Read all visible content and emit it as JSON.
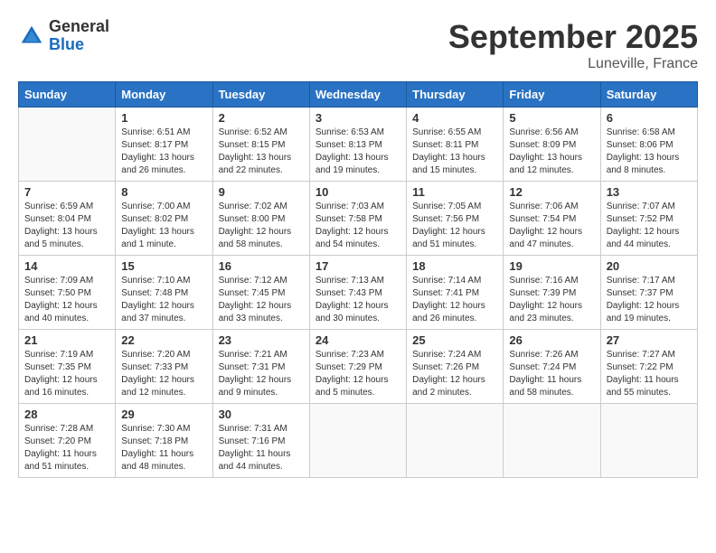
{
  "header": {
    "logo_general": "General",
    "logo_blue": "Blue",
    "title": "September 2025",
    "location": "Luneville, France"
  },
  "days_of_week": [
    "Sunday",
    "Monday",
    "Tuesday",
    "Wednesday",
    "Thursday",
    "Friday",
    "Saturday"
  ],
  "weeks": [
    [
      {
        "day": "",
        "info": ""
      },
      {
        "day": "1",
        "info": "Sunrise: 6:51 AM\nSunset: 8:17 PM\nDaylight: 13 hours\nand 26 minutes."
      },
      {
        "day": "2",
        "info": "Sunrise: 6:52 AM\nSunset: 8:15 PM\nDaylight: 13 hours\nand 22 minutes."
      },
      {
        "day": "3",
        "info": "Sunrise: 6:53 AM\nSunset: 8:13 PM\nDaylight: 13 hours\nand 19 minutes."
      },
      {
        "day": "4",
        "info": "Sunrise: 6:55 AM\nSunset: 8:11 PM\nDaylight: 13 hours\nand 15 minutes."
      },
      {
        "day": "5",
        "info": "Sunrise: 6:56 AM\nSunset: 8:09 PM\nDaylight: 13 hours\nand 12 minutes."
      },
      {
        "day": "6",
        "info": "Sunrise: 6:58 AM\nSunset: 8:06 PM\nDaylight: 13 hours\nand 8 minutes."
      }
    ],
    [
      {
        "day": "7",
        "info": "Sunrise: 6:59 AM\nSunset: 8:04 PM\nDaylight: 13 hours\nand 5 minutes."
      },
      {
        "day": "8",
        "info": "Sunrise: 7:00 AM\nSunset: 8:02 PM\nDaylight: 13 hours\nand 1 minute."
      },
      {
        "day": "9",
        "info": "Sunrise: 7:02 AM\nSunset: 8:00 PM\nDaylight: 12 hours\nand 58 minutes."
      },
      {
        "day": "10",
        "info": "Sunrise: 7:03 AM\nSunset: 7:58 PM\nDaylight: 12 hours\nand 54 minutes."
      },
      {
        "day": "11",
        "info": "Sunrise: 7:05 AM\nSunset: 7:56 PM\nDaylight: 12 hours\nand 51 minutes."
      },
      {
        "day": "12",
        "info": "Sunrise: 7:06 AM\nSunset: 7:54 PM\nDaylight: 12 hours\nand 47 minutes."
      },
      {
        "day": "13",
        "info": "Sunrise: 7:07 AM\nSunset: 7:52 PM\nDaylight: 12 hours\nand 44 minutes."
      }
    ],
    [
      {
        "day": "14",
        "info": "Sunrise: 7:09 AM\nSunset: 7:50 PM\nDaylight: 12 hours\nand 40 minutes."
      },
      {
        "day": "15",
        "info": "Sunrise: 7:10 AM\nSunset: 7:48 PM\nDaylight: 12 hours\nand 37 minutes."
      },
      {
        "day": "16",
        "info": "Sunrise: 7:12 AM\nSunset: 7:45 PM\nDaylight: 12 hours\nand 33 minutes."
      },
      {
        "day": "17",
        "info": "Sunrise: 7:13 AM\nSunset: 7:43 PM\nDaylight: 12 hours\nand 30 minutes."
      },
      {
        "day": "18",
        "info": "Sunrise: 7:14 AM\nSunset: 7:41 PM\nDaylight: 12 hours\nand 26 minutes."
      },
      {
        "day": "19",
        "info": "Sunrise: 7:16 AM\nSunset: 7:39 PM\nDaylight: 12 hours\nand 23 minutes."
      },
      {
        "day": "20",
        "info": "Sunrise: 7:17 AM\nSunset: 7:37 PM\nDaylight: 12 hours\nand 19 minutes."
      }
    ],
    [
      {
        "day": "21",
        "info": "Sunrise: 7:19 AM\nSunset: 7:35 PM\nDaylight: 12 hours\nand 16 minutes."
      },
      {
        "day": "22",
        "info": "Sunrise: 7:20 AM\nSunset: 7:33 PM\nDaylight: 12 hours\nand 12 minutes."
      },
      {
        "day": "23",
        "info": "Sunrise: 7:21 AM\nSunset: 7:31 PM\nDaylight: 12 hours\nand 9 minutes."
      },
      {
        "day": "24",
        "info": "Sunrise: 7:23 AM\nSunset: 7:29 PM\nDaylight: 12 hours\nand 5 minutes."
      },
      {
        "day": "25",
        "info": "Sunrise: 7:24 AM\nSunset: 7:26 PM\nDaylight: 12 hours\nand 2 minutes."
      },
      {
        "day": "26",
        "info": "Sunrise: 7:26 AM\nSunset: 7:24 PM\nDaylight: 11 hours\nand 58 minutes."
      },
      {
        "day": "27",
        "info": "Sunrise: 7:27 AM\nSunset: 7:22 PM\nDaylight: 11 hours\nand 55 minutes."
      }
    ],
    [
      {
        "day": "28",
        "info": "Sunrise: 7:28 AM\nSunset: 7:20 PM\nDaylight: 11 hours\nand 51 minutes."
      },
      {
        "day": "29",
        "info": "Sunrise: 7:30 AM\nSunset: 7:18 PM\nDaylight: 11 hours\nand 48 minutes."
      },
      {
        "day": "30",
        "info": "Sunrise: 7:31 AM\nSunset: 7:16 PM\nDaylight: 11 hours\nand 44 minutes."
      },
      {
        "day": "",
        "info": ""
      },
      {
        "day": "",
        "info": ""
      },
      {
        "day": "",
        "info": ""
      },
      {
        "day": "",
        "info": ""
      }
    ]
  ]
}
